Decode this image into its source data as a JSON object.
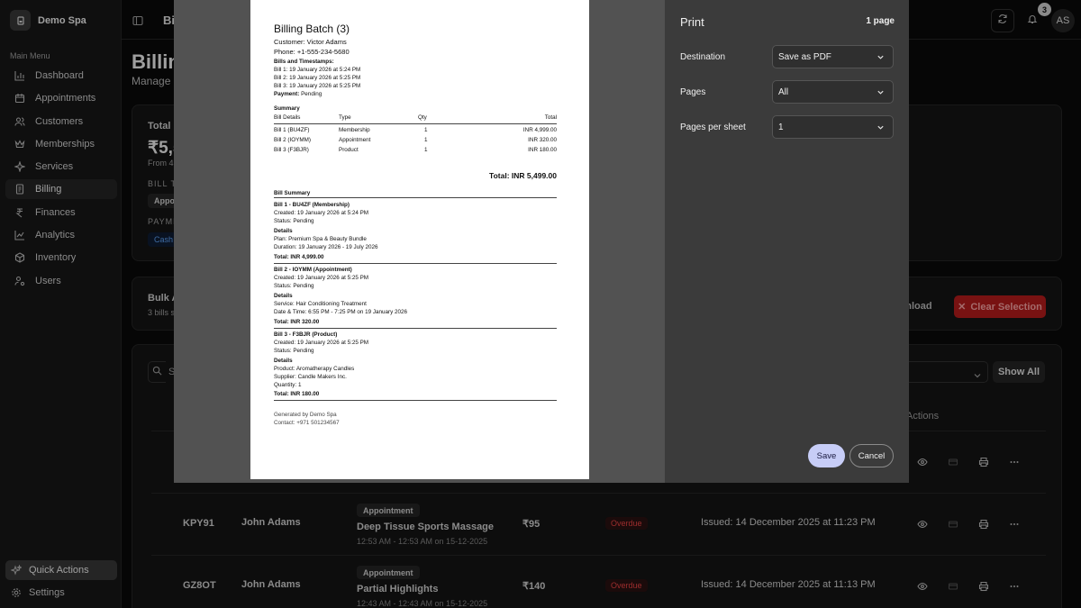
{
  "brand": {
    "name": "Demo Spa"
  },
  "sidebar": {
    "section_title": "Main Menu",
    "items": [
      {
        "label": "Dashboard",
        "icon": "chart-icon"
      },
      {
        "label": "Appointments",
        "icon": "calendar-icon"
      },
      {
        "label": "Customers",
        "icon": "users-icon"
      },
      {
        "label": "Memberships",
        "icon": "crown-icon"
      },
      {
        "label": "Services",
        "icon": "sparkle-icon"
      },
      {
        "label": "Billing",
        "icon": "receipt-icon"
      },
      {
        "label": "Finances",
        "icon": "rupee-icon"
      },
      {
        "label": "Analytics",
        "icon": "analytics-icon"
      },
      {
        "label": "Inventory",
        "icon": "box-icon"
      },
      {
        "label": "Users",
        "icon": "user-gear-icon"
      }
    ],
    "quick_actions": "Quick Actions",
    "settings": "Settings"
  },
  "topbar": {
    "crumb": "Bil",
    "notif_count": "3",
    "avatar": "AS"
  },
  "page": {
    "title": "Billin",
    "subtitle": "Manage"
  },
  "bg_fragments": {
    "total_label": "Total R",
    "total_value": "₹5,5",
    "total_from": "From 4",
    "bill_type": "BILL TY",
    "chip_appo": "Appo",
    "payment": "PAYME",
    "chip_cash": "Cash",
    "bulk": "Bulk A",
    "bulk_sub": "3 bills s",
    "search": "S",
    "download": "ownload",
    "clear": "Clear Selection",
    "show_all": "Show All",
    "actions": "Actions"
  },
  "rows": [
    {
      "id": "KPY91",
      "customer": "John Adams",
      "type": "Appointment",
      "service": "Deep Tissue Sports Massage",
      "when": "12:53 AM - 12:53 AM on 15-12-2025",
      "amount": "₹95",
      "status": "Overdue",
      "issued": "Issued: 14 December 2025 at 11:23 PM"
    },
    {
      "id": "GZ8OT",
      "customer": "John Adams",
      "type": "Appointment",
      "service": "Partial Highlights",
      "when": "12:43 AM - 12:43 AM on 15-12-2025",
      "amount": "₹140",
      "status": "Overdue",
      "issued": "Issued: 14 December 2025 at 11:13 PM"
    }
  ],
  "print": {
    "title": "Print",
    "pages_count": "1 page",
    "destination_label": "Destination",
    "destination_value": "Save as PDF",
    "pages_label": "Pages",
    "pages_value": "All",
    "pps_label": "Pages per sheet",
    "pps_value": "1",
    "save": "Save",
    "cancel": "Cancel"
  },
  "doc": {
    "title": "Billing Batch (3)",
    "customer": "Customer: Victor Adams",
    "phone": "Phone: +1-555-234-5680",
    "bt_heading": "Bills and Timestamps:",
    "bt": [
      "Bill 1: 19 January 2026 at 5:24 PM",
      "Bill 2: 19 January 2026 at 5:25 PM",
      "Bill 3: 19 January 2026 at 5:25 PM"
    ],
    "payment_label": "Payment:",
    "payment_value": " Pending",
    "summary_heading": "Summary",
    "table_headers": [
      "Bill Details",
      "Type",
      "Qty",
      "Total"
    ],
    "table_rows": [
      [
        "Bill 1 (BU4ZF)",
        "Membership",
        "1",
        "INR 4,999.00"
      ],
      [
        "Bill 2 (IOYMM)",
        "Appointment",
        "1",
        "INR 320.00"
      ],
      [
        "Bill 3 (F3BJR)",
        "Product",
        "1",
        "INR 180.00"
      ]
    ],
    "grand_total": "Total:  INR 5,499.00",
    "bill_summary_heading": "Bill Summary",
    "bills": [
      {
        "head": "Bill 1 - BU4ZF (Membership)",
        "created": "Created: 19 January 2026 at 5:24 PM",
        "status": "Status: Pending",
        "details_label": "Details",
        "d1": "Plan: Premium Spa & Beauty Bundle",
        "d2": "Duration: 19 January 2026 - 19 July 2026",
        "d3": "",
        "total": "Total: INR 4,999.00"
      },
      {
        "head": "Bill 2 - IOYMM (Appointment)",
        "created": "Created: 19 January 2026 at 5:25 PM",
        "status": "Status: Pending",
        "details_label": "Details",
        "d1": "Service: Hair Conditioning Treatment",
        "d2": "Date & Time: 6:55 PM - 7:25 PM on 19 January 2026",
        "d3": "",
        "total": "Total: INR 320.00"
      },
      {
        "head": "Bill 3 - F3BJR (Product)",
        "created": "Created: 19 January 2026 at 5:25 PM",
        "status": "Status: Pending",
        "details_label": "Details",
        "d1": "Product: Aromatherapy Candles",
        "d2": "Supplier: Candle Makers Inc.",
        "d3": "Quantity: 1",
        "total": "Total: INR 180.00"
      }
    ],
    "footer1": "Generated by Demo Spa",
    "footer2": "Contact: +971 501234567"
  }
}
